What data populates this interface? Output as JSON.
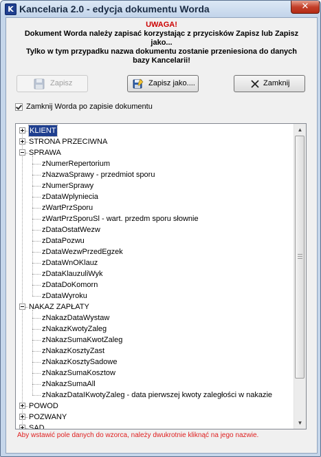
{
  "window": {
    "title": "Kancelaria 2.0 - edycja  dokumentu Worda",
    "app_icon_letter": "K",
    "close_glyph": "✕"
  },
  "notice": {
    "heading": "UWAGA!",
    "line1": "Dokument Worda należy zapisać korzystając z przycisków Zapisz lub Zapisz",
    "line2": "jako...",
    "line3": "Tylko w tym przypadku nazwa dokumentu zostanie przeniesiona do danych",
    "line4": "bazy Kancelarii!"
  },
  "buttons": {
    "save": "Zapisz",
    "save_as": "Zapisz jako....",
    "close": "Zamknij"
  },
  "checkbox": {
    "label": "Zamknij Worda po zapisie dokumentu",
    "checked": true
  },
  "tree": {
    "nodes": [
      {
        "label": "KLIENT",
        "expanded": false,
        "selected": true,
        "children": []
      },
      {
        "label": "STRONA PRZECIWNA",
        "expanded": false,
        "children": []
      },
      {
        "label": "SPRAWA",
        "expanded": true,
        "children": [
          "zNumerRepertorium",
          "zNazwaSprawy - przedmiot sporu",
          "zNumerSprawy",
          "zDataWplyniecia",
          "zWartPrzSporu",
          "zWartPrzSporuSl - wart. przedm sporu słownie",
          "zDataOstatWezw",
          "zDataPozwu",
          "zDataWezwPrzedEgzek",
          "zDataWnOKlauz",
          "zDataKlauzuliWyk",
          "zDataDoKomorn",
          "zDataWyroku"
        ]
      },
      {
        "label": "NAKAZ ZAPŁATY",
        "expanded": true,
        "children": [
          "zNakazDataWystaw",
          "zNakazKwotyZaleg",
          "zNakazSumaKwotZaleg",
          "zNakazKosztyZast",
          "zNakazKosztySadowe",
          "zNakazSumaKosztow",
          "zNakazSumaAll",
          "zNakazDataIKwotyZaleg - data pierwszej kwoty zaległości w nakazie"
        ]
      },
      {
        "label": "POWOD",
        "expanded": false,
        "children": []
      },
      {
        "label": "POZWANY",
        "expanded": false,
        "children": []
      },
      {
        "label": "SAD",
        "expanded": false,
        "children": []
      }
    ]
  },
  "footer": {
    "hint": "Aby wstawić pole danych do wzorca, należy dwukrotnie kliknąć na jego nazwie."
  },
  "colors": {
    "warning": "#cc0000",
    "selection": "#1f3f8f",
    "hint": "#e02020"
  }
}
